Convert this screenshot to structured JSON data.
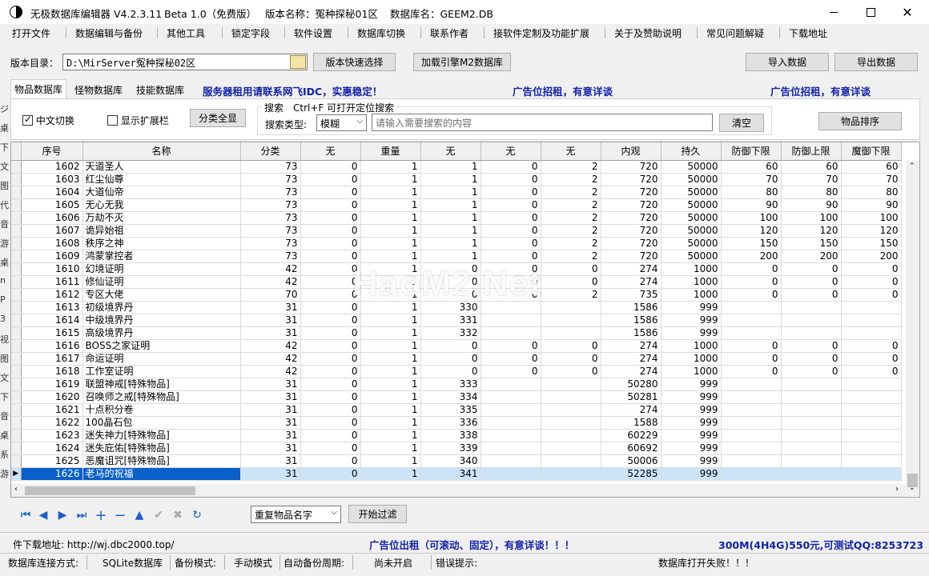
{
  "window": {
    "app_name": "无极数据库编辑器 V4.2.3.11",
    "edition": "Beta 1.0（免费版）",
    "version_label": "版本名称：冤种探秘01区",
    "db_label": "数据库名：GEEM2.DB"
  },
  "menu": [
    "打开文件",
    "数据编辑与备份",
    "其他工具",
    "锁定字段",
    "软件设置",
    "数据库切换",
    "联系作者",
    "接软件定制及功能扩展",
    "关于及赞助说明",
    "常见问题解疑",
    "下载地址"
  ],
  "toolbar": {
    "dir_label": "版本目录：",
    "dir_value": "D:\\MirServer冤种探秘02区",
    "quick_select": "版本快速选择",
    "load_db": "加载引擎M2数据库",
    "import": "导入数据",
    "export": "导出数据"
  },
  "tabs": [
    "物品数据库",
    "怪物数据库",
    "技能数据库"
  ],
  "ads": {
    "server": "服务器租用请联系网飞IDC，实惠稳定！",
    "ad1": "广告位招租，有意详谈",
    "ad2": "广告位招租，有意详谈"
  },
  "panel": {
    "chinese_toggle": "中文切换",
    "show_ext": "显示扩展栏",
    "classify_all": "分类全显",
    "search_title": "搜索　Ctrl+F 可打开定位搜索",
    "search_type_label": "搜索类型:",
    "search_type_value": "模糊",
    "search_placeholder": "请输入需要搜索的内容",
    "clear": "清空",
    "sort": "物品排序"
  },
  "columns": [
    "序号",
    "名称",
    "分类",
    "无",
    "重量",
    "无",
    "无",
    "无",
    "内观",
    "持久",
    "防御下限",
    "防御上限",
    "魔御下限"
  ],
  "rows": [
    [
      "1602",
      "天道圣人",
      "73",
      "0",
      "1",
      "1",
      "0",
      "2",
      "720",
      "50000",
      "60",
      "60",
      "60"
    ],
    [
      "1603",
      "红尘仙尊",
      "73",
      "0",
      "1",
      "1",
      "0",
      "2",
      "720",
      "50000",
      "70",
      "70",
      "70"
    ],
    [
      "1604",
      "大道仙帝",
      "73",
      "0",
      "1",
      "1",
      "0",
      "2",
      "720",
      "50000",
      "80",
      "80",
      "80"
    ],
    [
      "1605",
      "无心无我",
      "73",
      "0",
      "1",
      "1",
      "0",
      "2",
      "720",
      "50000",
      "90",
      "90",
      "90"
    ],
    [
      "1606",
      "万劫不灭",
      "73",
      "0",
      "1",
      "1",
      "0",
      "2",
      "720",
      "50000",
      "100",
      "100",
      "100"
    ],
    [
      "1607",
      "诡异始祖",
      "73",
      "0",
      "1",
      "1",
      "0",
      "2",
      "720",
      "50000",
      "120",
      "120",
      "120"
    ],
    [
      "1608",
      "秩序之神",
      "73",
      "0",
      "1",
      "1",
      "0",
      "2",
      "720",
      "50000",
      "150",
      "150",
      "150"
    ],
    [
      "1609",
      "鸿蒙掌控者",
      "73",
      "0",
      "1",
      "1",
      "0",
      "2",
      "720",
      "50000",
      "200",
      "200",
      "200"
    ],
    [
      "1610",
      "幻境证明",
      "42",
      "0",
      "1",
      "0",
      "0",
      "0",
      "274",
      "1000",
      "0",
      "0",
      "0"
    ],
    [
      "1611",
      "修仙证明",
      "42",
      "0",
      "1",
      "0",
      "0",
      "0",
      "274",
      "1000",
      "0",
      "0",
      "0"
    ],
    [
      "1612",
      "专区大佬",
      "70",
      "0",
      "1",
      "0",
      "0",
      "2",
      "735",
      "1000",
      "0",
      "0",
      "0"
    ],
    [
      "1613",
      "初级境界丹",
      "31",
      "0",
      "1",
      "330",
      "",
      "",
      "1586",
      "999",
      "",
      "",
      ""
    ],
    [
      "1614",
      "中级境界丹",
      "31",
      "0",
      "1",
      "331",
      "",
      "",
      "1586",
      "999",
      "",
      "",
      ""
    ],
    [
      "1615",
      "高级境界丹",
      "31",
      "0",
      "1",
      "332",
      "",
      "",
      "1586",
      "999",
      "",
      "",
      ""
    ],
    [
      "1616",
      "BOSS之家证明",
      "42",
      "0",
      "1",
      "0",
      "0",
      "0",
      "274",
      "1000",
      "0",
      "0",
      "0"
    ],
    [
      "1617",
      "命运证明",
      "42",
      "0",
      "1",
      "0",
      "0",
      "0",
      "274",
      "1000",
      "0",
      "0",
      "0"
    ],
    [
      "1618",
      "工作室证明",
      "42",
      "0",
      "1",
      "0",
      "0",
      "0",
      "274",
      "1000",
      "0",
      "0",
      "0"
    ],
    [
      "1619",
      "联盟神戒[特殊物品]",
      "31",
      "0",
      "1",
      "333",
      "",
      "",
      "50280",
      "999",
      "",
      "",
      ""
    ],
    [
      "1620",
      "召唤师之戒[特殊物品]",
      "31",
      "0",
      "1",
      "334",
      "",
      "",
      "50281",
      "999",
      "",
      "",
      ""
    ],
    [
      "1621",
      "十点积分卷",
      "31",
      "0",
      "1",
      "335",
      "",
      "",
      "274",
      "999",
      "",
      "",
      ""
    ],
    [
      "1622",
      "100晶石包",
      "31",
      "0",
      "1",
      "336",
      "",
      "",
      "1588",
      "999",
      "",
      "",
      ""
    ],
    [
      "1623",
      "迷失神力[特殊物品]",
      "31",
      "0",
      "1",
      "338",
      "",
      "",
      "60229",
      "999",
      "",
      "",
      ""
    ],
    [
      "1624",
      "迷失庇佑[特殊物品]",
      "31",
      "0",
      "1",
      "339",
      "",
      "",
      "60692",
      "999",
      "",
      "",
      ""
    ],
    [
      "1625",
      "恶魔诅咒[特殊物品]",
      "31",
      "0",
      "1",
      "340",
      "",
      "",
      "50006",
      "999",
      "",
      "",
      ""
    ],
    [
      "1626",
      "老马的祝福",
      "31",
      "0",
      "1",
      "341",
      "",
      "",
      "52285",
      "999",
      "",
      "",
      ""
    ]
  ],
  "watermark": "HaoM2.Net",
  "nav": {
    "filter_value": "重复物品名字",
    "start_filter": "开始过滤"
  },
  "footer": {
    "download": "件下载地址: http://wj.dbc2000.top/",
    "ad": "广告位出租（可滚动、固定），有意详谈！！！",
    "promo": "300M(4H4G)550元,可测试QQ:8253723"
  },
  "status": {
    "conn_label": "数据库连接方式:",
    "conn_value": "SQLite数据库",
    "backup_label": "备份模式:",
    "backup_value": "手动模式",
    "auto_label": "自动备份周期:",
    "auto_value": "尚未开启",
    "error_label": "错误提示:",
    "error_value": "数据库打开失败！！！"
  },
  "left_strip": [
    "ジ",
    "桌",
    "下",
    "文",
    "图",
    "代",
    "音",
    "游",
    "桌",
    "n",
    "P",
    "3",
    "视",
    "图",
    "文",
    "下",
    "音",
    "桌",
    "系",
    "游"
  ]
}
